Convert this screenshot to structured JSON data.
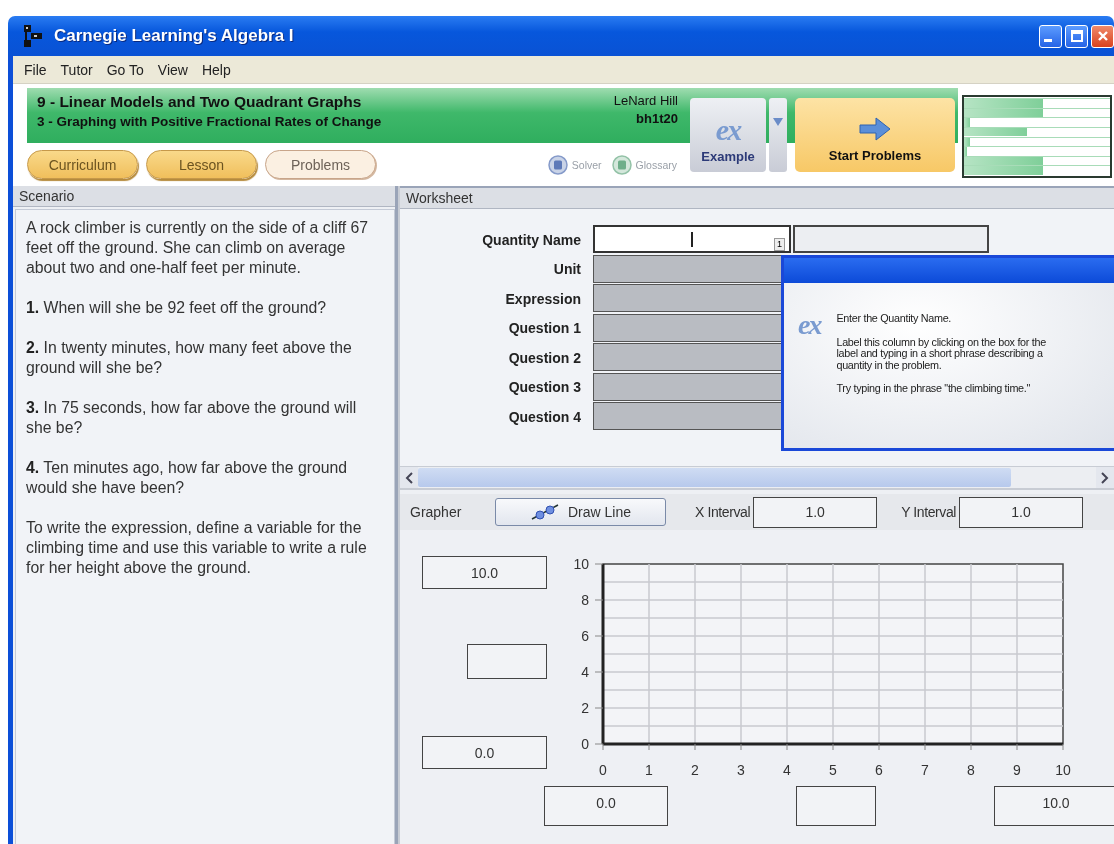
{
  "window": {
    "title": "Carnegie Learning's Algebra I"
  },
  "menu": [
    "File",
    "Tutor",
    "Go To",
    "View",
    "Help"
  ],
  "header": {
    "unit": "9 - Linear Models and Two Quadrant Graphs",
    "section": "3 - Graphing with Positive Fractional Rates of Change",
    "student": "LeNard Hill",
    "login": "bh1t20"
  },
  "tabs": [
    {
      "label": "Curriculum",
      "selected": false
    },
    {
      "label": "Lesson",
      "selected": false
    },
    {
      "label": "Problems",
      "selected": true
    }
  ],
  "tools": [
    {
      "label": "Solver",
      "disabled": true
    },
    {
      "label": "Glossary",
      "disabled": true
    }
  ],
  "example_button": {
    "logo": "ex",
    "label": "Example"
  },
  "start_button": {
    "label": "Start Problems"
  },
  "skills": [
    {
      "level": 0.54
    },
    {
      "level": 0.54
    },
    {
      "level": 0.04
    },
    {
      "level": 0.43
    },
    {
      "level": 0.04
    },
    {
      "level": 0.02
    },
    {
      "level": 0.54
    },
    {
      "level": 0.54
    }
  ],
  "scenario": {
    "title": "Scenario",
    "paragraphs": [
      "A rock climber is currently on the side of a cliff 67 feet off the ground. She can climb on average about two and one-half feet per minute.",
      "**1.** When will she be 92 feet off the ground?",
      "**2.** In twenty minutes, how many feet above the ground will she be?",
      "**3.** In 75 seconds, how far above the ground will she be?",
      "**4.** Ten minutes ago, how far above the ground would she have been?",
      "To write the expression, define a variable for the climbing time and use this variable to write a rule for her height above the ground."
    ]
  },
  "worksheet": {
    "title": "Worksheet",
    "cell_badge": "1",
    "rows": [
      {
        "label": "Quantity Name",
        "active": true
      },
      {
        "label": "Unit",
        "active": false
      },
      {
        "label": "Expression",
        "active": false
      },
      {
        "label": "Question 1",
        "active": false
      },
      {
        "label": "Question 2",
        "active": false
      },
      {
        "label": "Question 3",
        "active": false
      },
      {
        "label": "Question 4",
        "active": false
      }
    ]
  },
  "hint": {
    "logo": "ex",
    "paragraphs": [
      "Enter the Quantity Name.",
      "Label this column by clicking on the box for the label and typing in a short phrase describing a quantity in the problem.",
      "Try typing in the phrase \"the climbing time.\""
    ]
  },
  "grapher": {
    "title": "Grapher",
    "draw_button": "Draw Line",
    "x_interval": {
      "label": "X Interval",
      "value": "1.0"
    },
    "y_interval": {
      "label": "Y Interval",
      "value": "1.0"
    },
    "y_max": "10.0",
    "y_min": "0.0",
    "x_min": "0.0",
    "x_max": "10.0",
    "chart_data": {
      "type": "line",
      "grid": true,
      "xlim": [
        0,
        10
      ],
      "ylim": [
        0,
        10
      ],
      "xticks": [
        0,
        1,
        2,
        3,
        4,
        5,
        6,
        7,
        8,
        9,
        10
      ],
      "yticks": [
        0,
        2,
        4,
        6,
        8,
        10
      ]
    }
  }
}
